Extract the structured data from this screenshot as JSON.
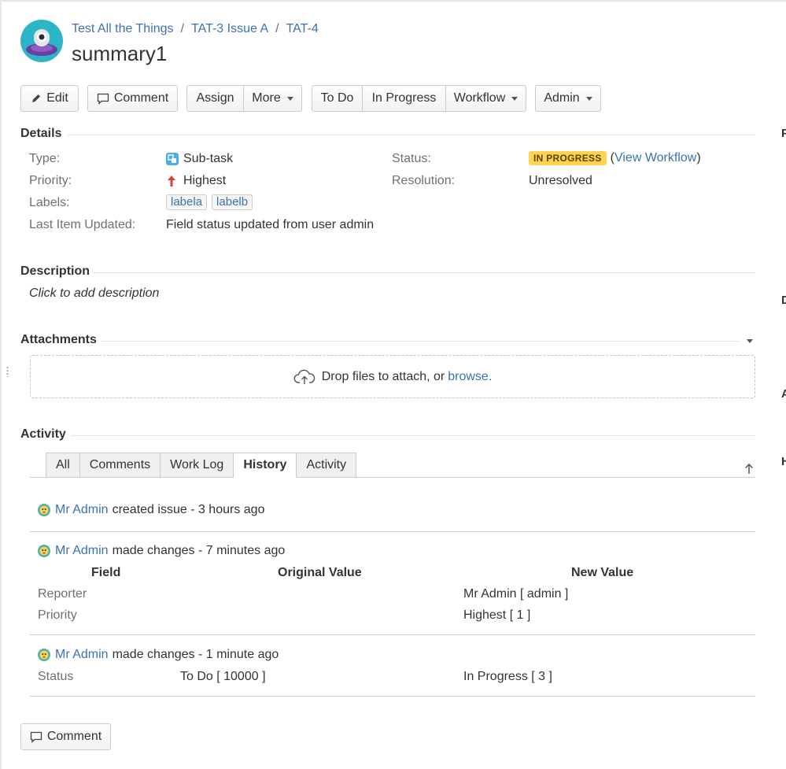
{
  "breadcrumb": {
    "project": "Test All the Things",
    "parent": "TAT-3 Issue A",
    "issue_key": "TAT-4",
    "separator": "/"
  },
  "issue": {
    "summary": "summary1"
  },
  "toolbar": {
    "edit": "Edit",
    "comment": "Comment",
    "assign": "Assign",
    "more": "More",
    "to_do": "To Do",
    "in_progress": "In Progress",
    "workflow": "Workflow",
    "admin": "Admin"
  },
  "details": {
    "heading": "Details",
    "type_label": "Type:",
    "type_value": "Sub-task",
    "priority_label": "Priority:",
    "priority_value": "Highest",
    "labels_label": "Labels:",
    "labels": [
      "labela",
      "labelb"
    ],
    "last_updated_label": "Last Item Updated:",
    "last_updated_value": "Field status updated from user admin",
    "status_label": "Status:",
    "status_value": "IN PROGRESS",
    "view_workflow_open": "(",
    "view_workflow": "View Workflow",
    "view_workflow_close": ")",
    "resolution_label": "Resolution:",
    "resolution_value": "Unresolved"
  },
  "description": {
    "heading": "Description",
    "placeholder": "Click to add description"
  },
  "attachments": {
    "heading": "Attachments",
    "drop_text": "Drop files to attach, or",
    "browse": "browse."
  },
  "activity": {
    "heading": "Activity",
    "tabs": [
      "All",
      "Comments",
      "Work Log",
      "History",
      "Activity"
    ],
    "active_tab": "History",
    "entries": [
      {
        "user": "Mr Admin",
        "action": "created issue - 3 hours ago"
      },
      {
        "user": "Mr Admin",
        "action": "made changes - 7 minutes ago"
      },
      {
        "user": "Mr Admin",
        "action": "made changes - 1 minute ago"
      }
    ],
    "columns": {
      "field": "Field",
      "original": "Original Value",
      "new": "New Value"
    },
    "changes": [
      {
        "field": "Reporter",
        "original": "",
        "new": "Mr Admin [ admin ]"
      },
      {
        "field": "Priority",
        "original": "",
        "new": "Highest [ 1 ]"
      },
      {
        "field": "Status",
        "original": "To Do [ 10000 ]",
        "new": "In Progress [ 3 ]"
      }
    ]
  },
  "footer": {
    "comment": "Comment"
  },
  "right_edge_letters": [
    "P",
    "D",
    "A",
    "H"
  ],
  "colors": {
    "link": "#3b73af",
    "lozenge": "#ffd351",
    "priority": "#d04437"
  }
}
